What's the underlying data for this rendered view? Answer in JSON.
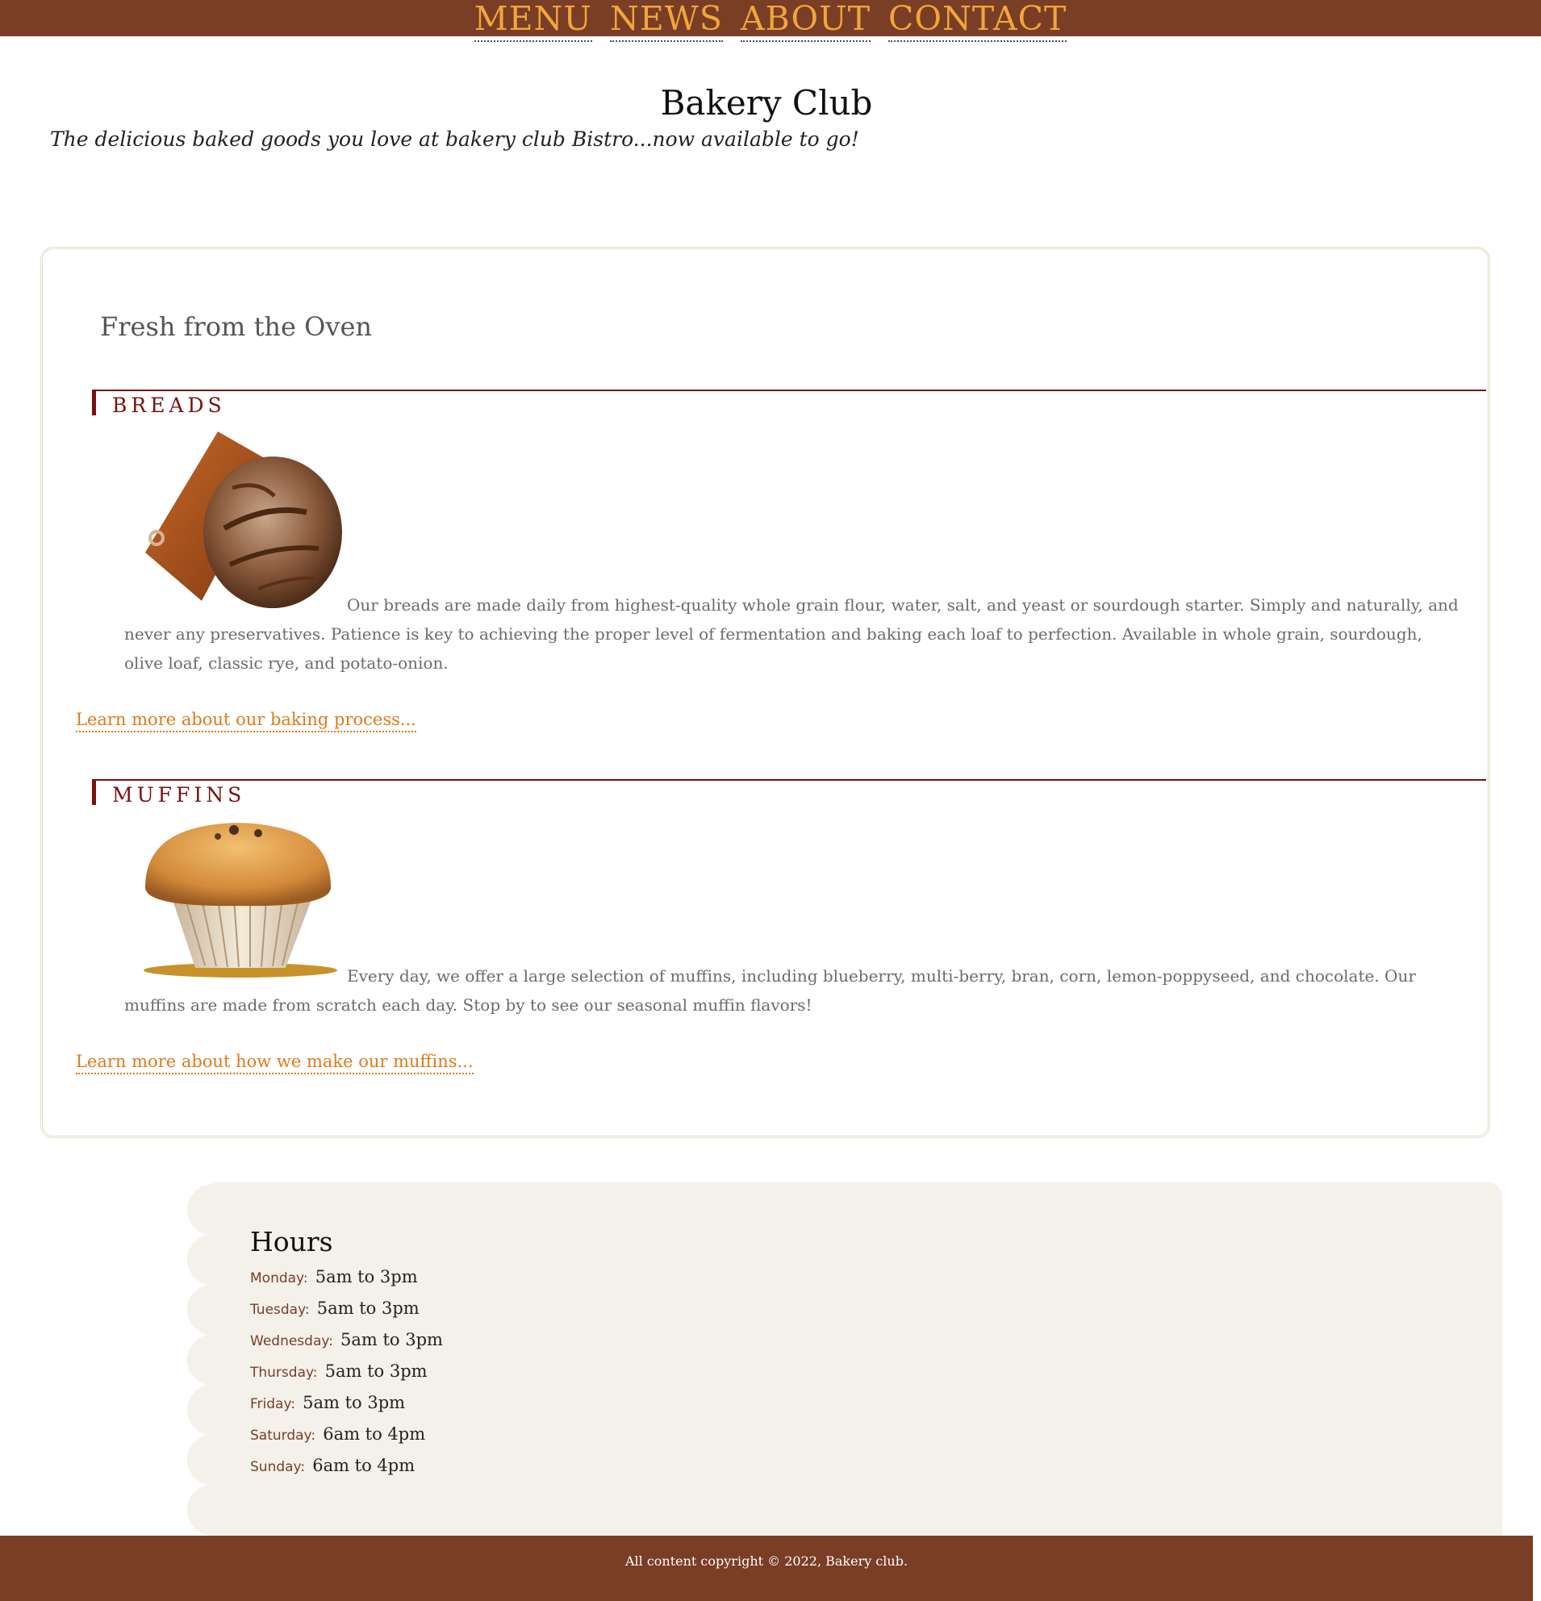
{
  "nav": {
    "items": [
      "MENU",
      "NEWS",
      "ABOUT",
      "CONTACT"
    ]
  },
  "header": {
    "title": "Bakery Club",
    "tagline": "The delicious baked goods you love at bakery club Bistro...now available to go!"
  },
  "main": {
    "heading": "Fresh from the Oven",
    "sections": [
      {
        "category": "BREADS",
        "image_icon": "bread-loaf-on-board",
        "description": "Our breads are made daily from highest-quality whole grain flour, water, salt, and yeast or sourdough starter. Simply and naturally, and never any preservatives. Patience is key to achieving the proper level of fermentation and baking each loaf to perfection. Available in whole grain, sourdough, olive loaf, classic rye, and potato-onion.",
        "link": "Learn more about our baking process..."
      },
      {
        "category": "MUFFINS",
        "image_icon": "muffin",
        "description": "Every day, we offer a large selection of muffins, including blueberry, multi-berry, bran, corn, lemon-poppyseed, and chocolate. Our muffins are made from scratch each day. Stop by to see our seasonal muffin flavors!",
        "link": "Learn more about how we make our muffins..."
      }
    ]
  },
  "hours": {
    "title": "Hours",
    "days": [
      {
        "day": "Monday:",
        "time": "5am to 3pm"
      },
      {
        "day": "Tuesday:",
        "time": "5am to 3pm"
      },
      {
        "day": "Wednesday:",
        "time": "5am to 3pm"
      },
      {
        "day": "Thursday:",
        "time": "5am to 3pm"
      },
      {
        "day": "Friday:",
        "time": "5am to 3pm"
      },
      {
        "day": "Saturday:",
        "time": "6am to 4pm"
      },
      {
        "day": "Sunday:",
        "time": "6am to 4pm"
      }
    ]
  },
  "footer": {
    "copyright": "All content copyright © 2022, Bakery club."
  },
  "colors": {
    "brand_brown": "#7a3d26",
    "nav_text": "#f0a63a",
    "category_red": "#7b1010",
    "link_orange": "#e07a1a",
    "hours_bg": "#f4f1eb"
  }
}
